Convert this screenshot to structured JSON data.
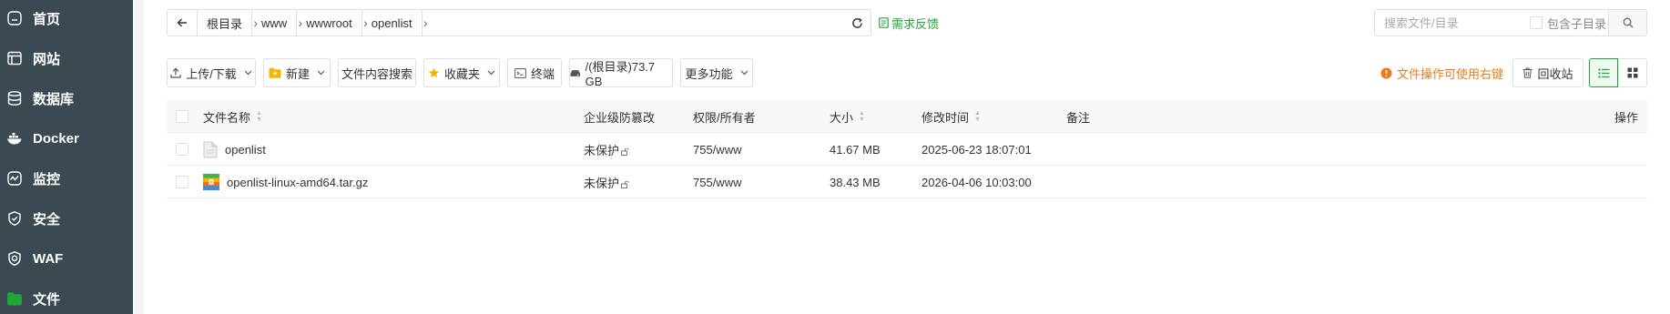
{
  "sidebar": {
    "items": [
      {
        "label": "首页",
        "icon": "home-icon"
      },
      {
        "label": "网站",
        "icon": "website-icon"
      },
      {
        "label": "数据库",
        "icon": "database-icon"
      },
      {
        "label": "Docker",
        "icon": "docker-icon"
      },
      {
        "label": "监控",
        "icon": "monitor-icon"
      },
      {
        "label": "安全",
        "icon": "shield-icon"
      },
      {
        "label": "WAF",
        "icon": "waf-icon"
      },
      {
        "label": "文件",
        "icon": "folder-icon",
        "active": true
      }
    ],
    "active_color": "#20a53a"
  },
  "path": {
    "crumbs": [
      "根目录",
      "www",
      "wwwroot",
      "openlist"
    ],
    "feedback_label": "需求反馈"
  },
  "search": {
    "placeholder": "搜索文件/目录",
    "include_sub_label": "包含子目录"
  },
  "toolbar": {
    "upload_label": "上传/下载",
    "new_label": "新建",
    "content_search_label": "文件内容搜索",
    "favorites_label": "收藏夹",
    "terminal_label": "终端",
    "disk_label": "/(根目录)73.7 GB",
    "more_label": "更多功能",
    "right_click_tip": "文件操作可使用右键",
    "recycle_label": "回收站"
  },
  "table": {
    "headers": {
      "name": "文件名称",
      "protection": "企业级防篡改",
      "permission": "权限/所有者",
      "size": "大小",
      "mtime": "修改时间",
      "note": "备注",
      "action": "操作"
    },
    "rows": [
      {
        "name": "openlist",
        "type": "file",
        "protection": "未保护",
        "permission": "755/www",
        "size": "41.67 MB",
        "mtime": "2025-06-23 18:07:01",
        "note": ""
      },
      {
        "name": "openlist-linux-amd64.tar.gz",
        "type": "archive",
        "protection": "未保护",
        "permission": "755/www",
        "size": "38.43 MB",
        "mtime": "2026-04-06 10:03:00",
        "note": ""
      }
    ]
  },
  "colors": {
    "sidebar_bg": "#3b4a52",
    "accent": "#20a53a",
    "warning": "#f0791d"
  }
}
